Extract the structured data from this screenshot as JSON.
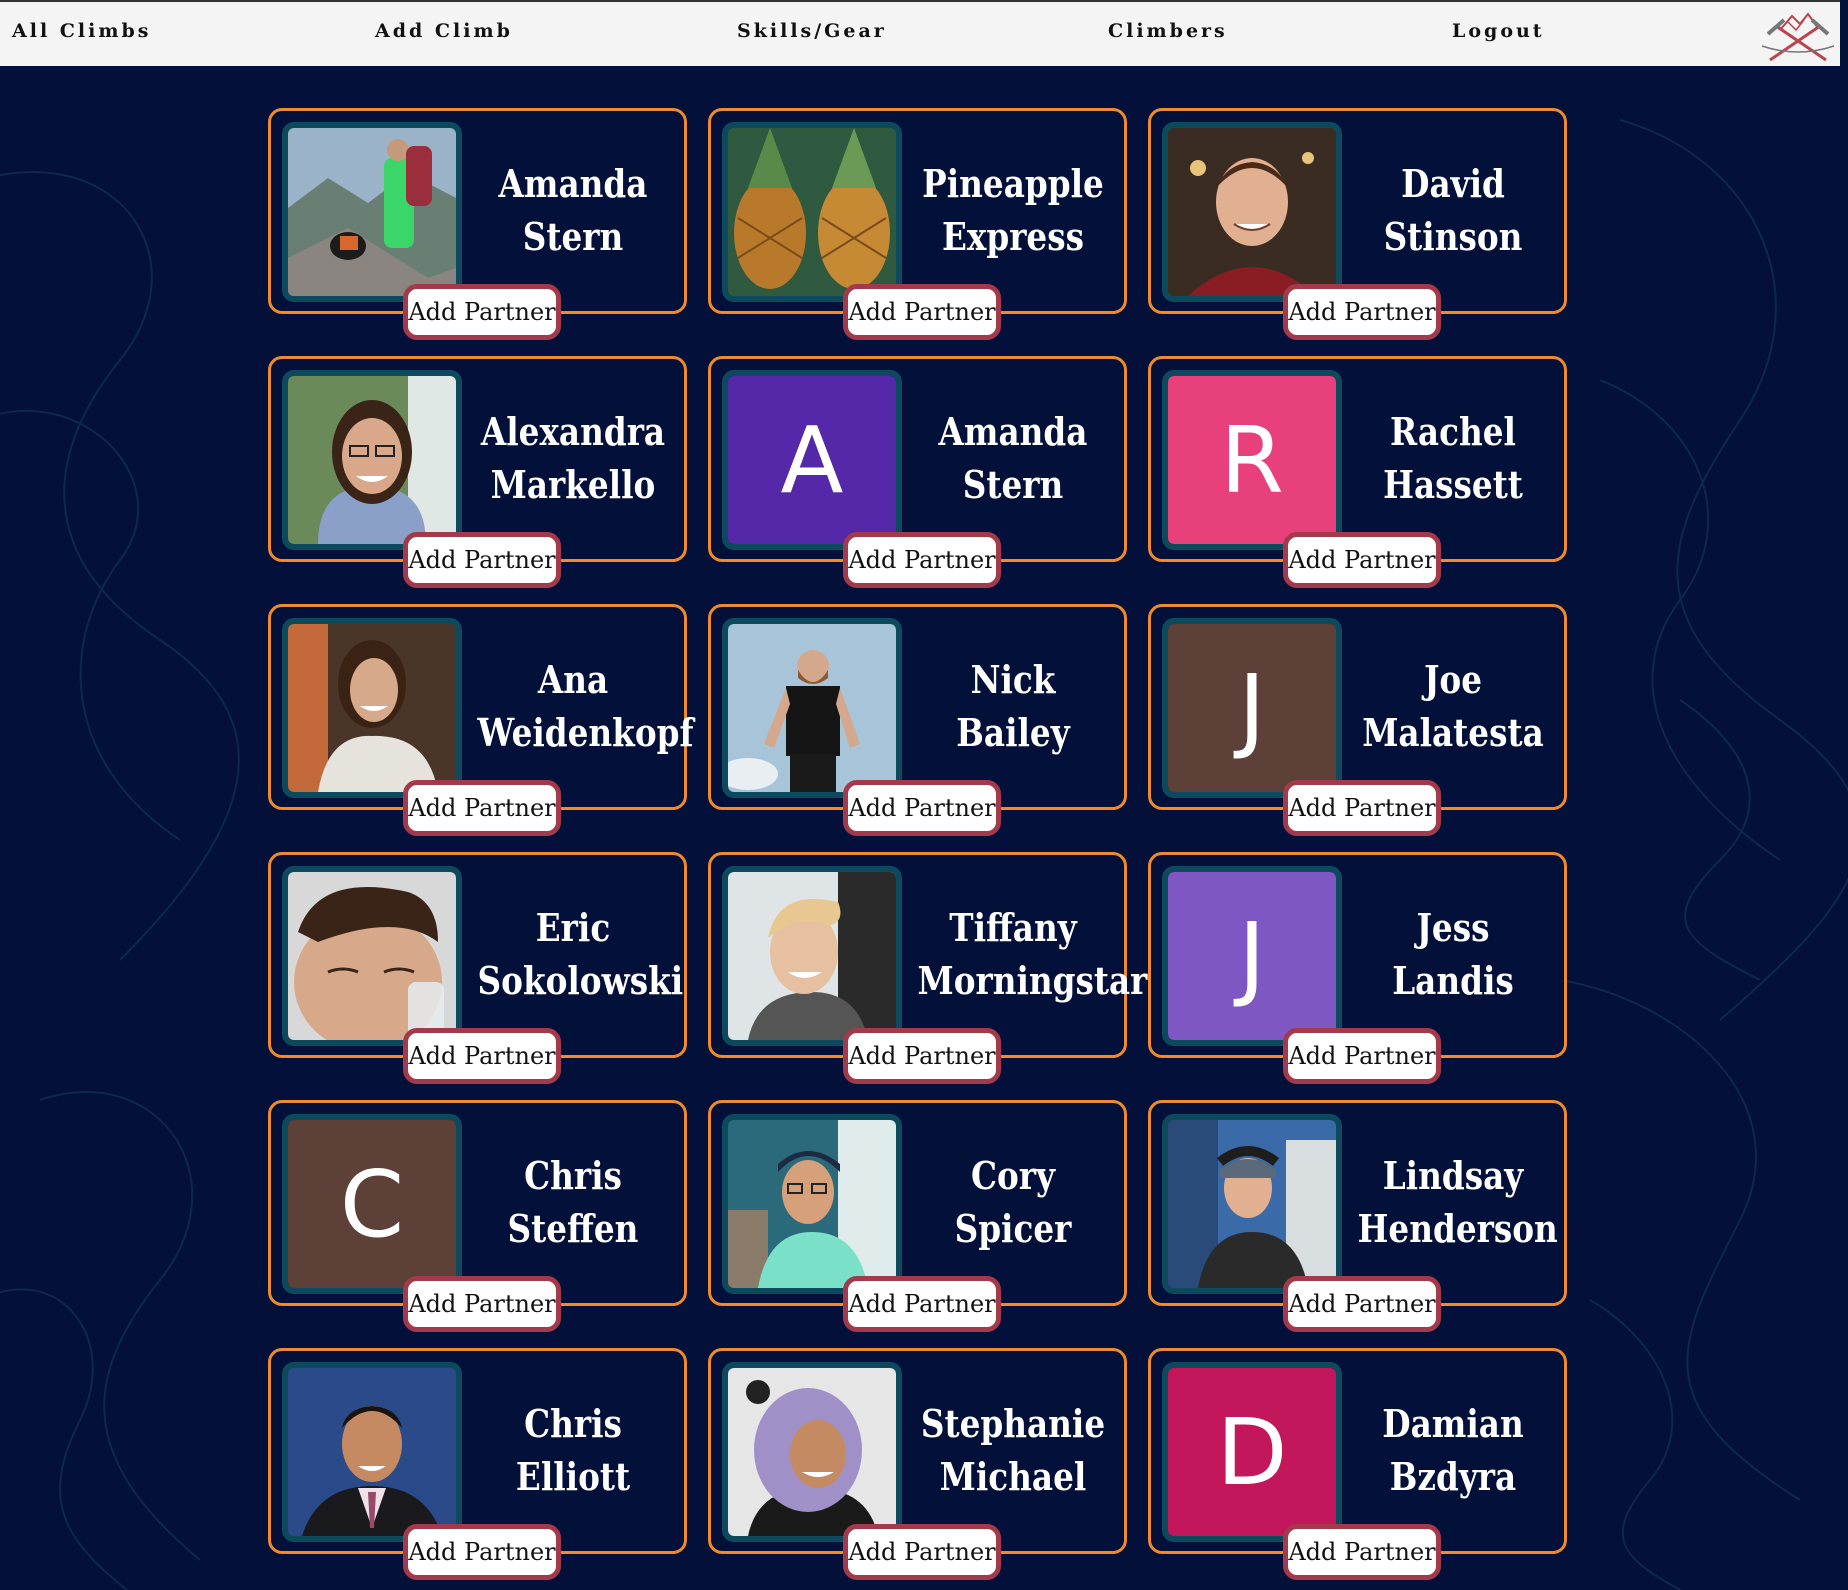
{
  "nav": {
    "all_climbs": "All Climbs",
    "add_climb": "Add Climb",
    "skills_gear": "Skills/Gear",
    "climbers": "Climbers",
    "logout": "Logout"
  },
  "colors": {
    "background": "#02103a",
    "card_border": "#f08a2a",
    "avatar_border": "#0e4a5e",
    "button_border": "#a23a4c"
  },
  "climbers": [
    {
      "first": "Amanda",
      "last": "Stern",
      "avatar": "photo",
      "button": "Add Partner"
    },
    {
      "first": "Pineapple",
      "last": "Express",
      "avatar": "photo",
      "button": "Add Partner"
    },
    {
      "first": "David",
      "last": "Stinson",
      "avatar": "photo",
      "button": "Add Partner"
    },
    {
      "first": "Alexandra",
      "last": "Markello",
      "avatar": "photo",
      "button": "Add Partner"
    },
    {
      "first": "Amanda",
      "last": "Stern",
      "avatar": "letter",
      "letter": "A",
      "avatar_color": "#5428a8",
      "button": "Add Partner"
    },
    {
      "first": "Rachel",
      "last": "Hassett",
      "avatar": "letter",
      "letter": "R",
      "avatar_color": "#e8407a",
      "button": "Add Partner"
    },
    {
      "first": "Ana",
      "last": "Weidenkopf",
      "avatar": "photo",
      "button": "Add Partner"
    },
    {
      "first": "Nick",
      "last": "Bailey",
      "avatar": "photo",
      "button": "Add Partner"
    },
    {
      "first": "Joe",
      "last": "Malatesta",
      "avatar": "letter",
      "letter": "J",
      "avatar_color": "#5d4037",
      "button": "Add Partner"
    },
    {
      "first": "Eric",
      "last": "Sokolowski",
      "avatar": "photo",
      "button": "Add Partner"
    },
    {
      "first": "Tiffany",
      "last": "Morningstar",
      "avatar": "photo",
      "button": "Add Partner"
    },
    {
      "first": "Jess",
      "last": "Landis",
      "avatar": "letter",
      "letter": "J",
      "avatar_color": "#7e57c2",
      "button": "Add Partner"
    },
    {
      "first": "Chris",
      "last": "Steffen",
      "avatar": "letter",
      "letter": "C",
      "avatar_color": "#5d4037",
      "button": "Add Partner"
    },
    {
      "first": "Cory",
      "last": "Spicer",
      "avatar": "photo",
      "button": "Add Partner"
    },
    {
      "first": "Lindsay",
      "last": "Henderson",
      "avatar": "photo",
      "button": "Add Partner"
    },
    {
      "first": "Chris",
      "last": "Elliott",
      "avatar": "photo",
      "button": "Add Partner"
    },
    {
      "first": "Stephanie",
      "last": "Michael",
      "avatar": "photo",
      "button": "Add Partner"
    },
    {
      "first": "Damian",
      "last": "Bzdyra",
      "avatar": "letter",
      "letter": "D",
      "avatar_color": "#c2185b",
      "button": "Add Partner"
    }
  ]
}
